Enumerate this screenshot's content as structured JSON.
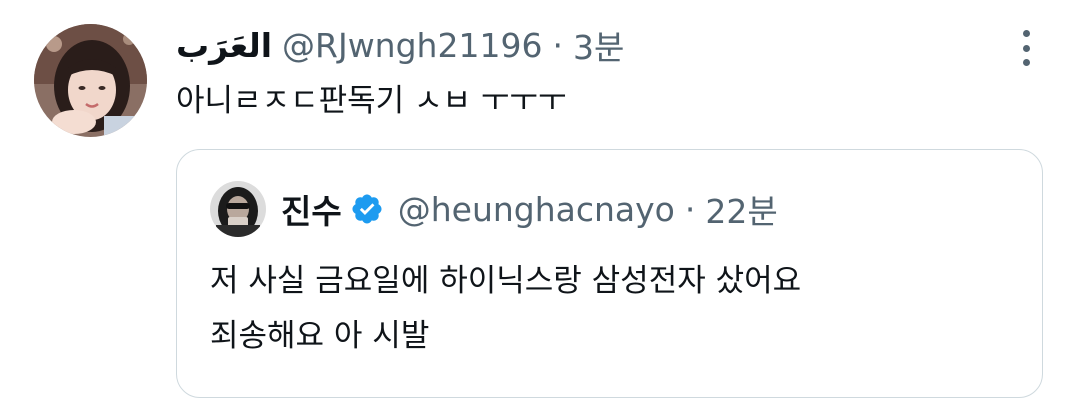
{
  "tweet": {
    "display_name": "العَرَب",
    "handle": "@RJwngh21196",
    "separator": "·",
    "time": "3분",
    "text": "아니ㄹㅈㄷ판독기 ㅅㅂ ㅜㅜㅜ",
    "avatar_icon": "profile-photo",
    "more_icon": "more-vertical-icon"
  },
  "quote": {
    "display_name": "진수",
    "verified_icon": "verified-badge-icon",
    "verified_color": "#1d9bf0",
    "handle": "@heunghacnayo",
    "separator": "·",
    "time": "22분",
    "text_lines": [
      "저 사실 금요일에 하이닉스랑 삼성전자 샀어요",
      "죄송해요 아 시발"
    ]
  },
  "colors": {
    "text": "#0f1419",
    "secondary": "#536471",
    "border": "#cfd9de",
    "accent": "#1d9bf0"
  }
}
